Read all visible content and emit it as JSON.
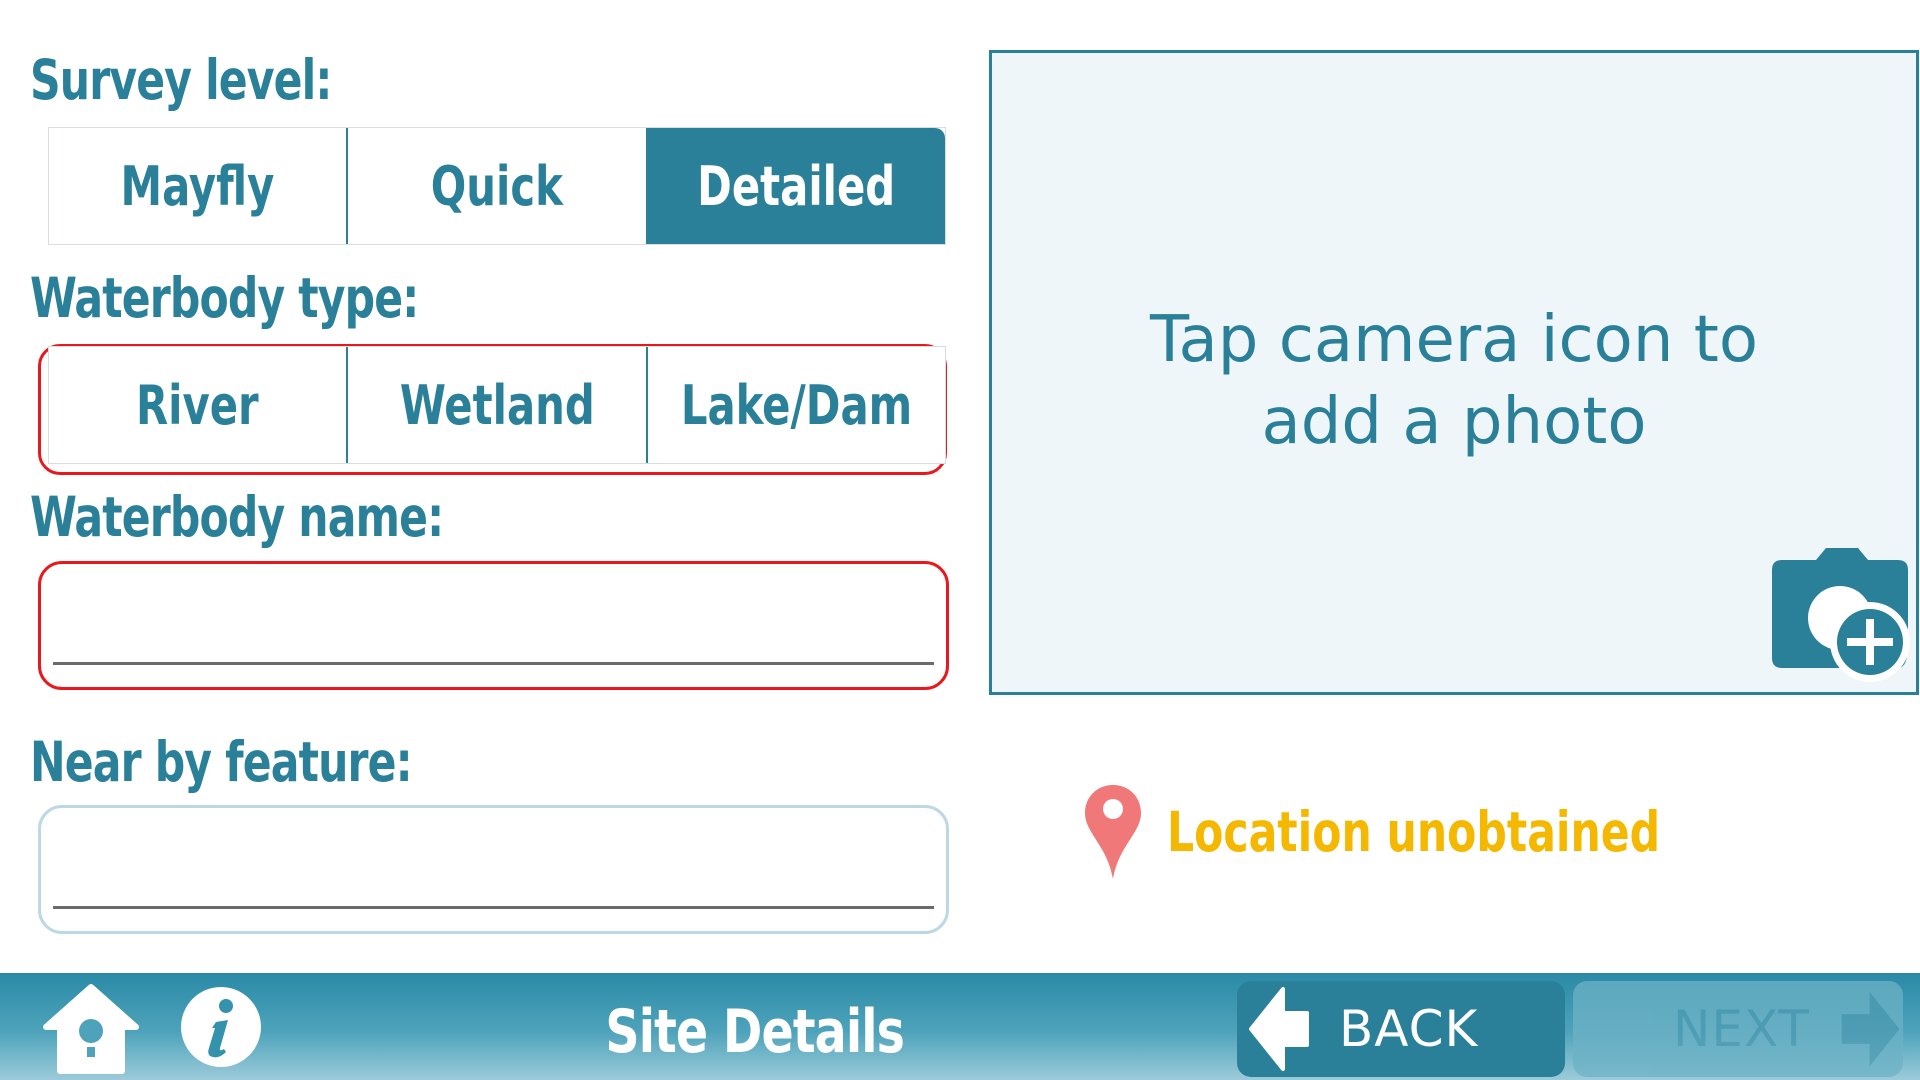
{
  "survey": {
    "label": "Survey level:",
    "options": [
      "Mayfly",
      "Quick",
      "Detailed"
    ],
    "selected": "Detailed"
  },
  "waterbody_type": {
    "label": "Waterbody type:",
    "options": [
      "River",
      "Wetland",
      "Lake/Dam"
    ]
  },
  "waterbody_name": {
    "label": "Waterbody name:",
    "value": ""
  },
  "nearby_feature": {
    "label": "Near by feature:",
    "value": ""
  },
  "photo": {
    "hint_line1": "Tap camera icon to",
    "hint_line2": "add a photo",
    "camera_icon": "camera-add-icon"
  },
  "location": {
    "icon": "map-pin-icon",
    "status": "Location unobtained"
  },
  "bottom_bar": {
    "title": "Site Details",
    "home_icon": "home-icon",
    "info_icon": "info-icon",
    "back_label": "BACK",
    "next_label": "NEXT"
  },
  "colors": {
    "primary": "#2a7f99",
    "error": "#e8191e",
    "warning": "#f5b800",
    "pin": "#f07878"
  }
}
